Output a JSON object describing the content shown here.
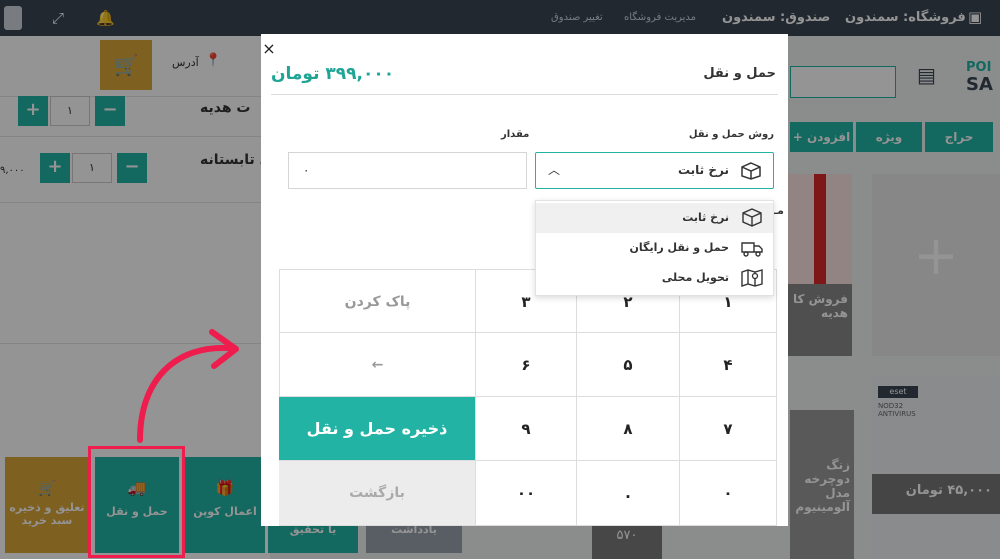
{
  "header": {
    "store": "فروشگاه: سمندون",
    "register": "صندوق: سمندون",
    "manage_store": "مدیریت فروشگاه",
    "change_register": "تغییر صندوق"
  },
  "background": {
    "address": "آدرس",
    "logo_text_1": "POI",
    "logo_text_2": "SA",
    "items": [
      {
        "name": "ت هدیه",
        "qty": "۱"
      },
      {
        "name": "گی تابستانه",
        "qty": "۱",
        "price": "۹,۰۰۰"
      }
    ],
    "categories": [
      "حراج",
      "ویژه",
      "افزودن"
    ],
    "products": [
      {
        "name": "فروش کا هدیه"
      },
      {
        "name": "زنگ دوچرخه مدل آلومینیوم"
      },
      {
        "name": "۴۵,۰۰۰ تومان"
      }
    ],
    "bottom_tiles": [
      "تعلیق و ذخیره سبد خرید",
      "حمل و نقل",
      "اعمال کوپن",
      "یادداشت",
      "یا تحقیق"
    ],
    "partial_price": "۵۷۰",
    "eset_label": "eset",
    "eset_sub": "NOD32 ANTIVIRUS"
  },
  "modal": {
    "close": "×",
    "title": "حمل و نقل",
    "total": "۳۹۹,۰۰۰ تومان",
    "method_label": "روش حمل و نقل",
    "amount_label": "مقدار",
    "selected_method": "نرخ ثابت",
    "amount_value": "۰",
    "extra_label": "مـ",
    "options": [
      "نرخ ثابت",
      "حمل و نقل رایگان",
      "تحویل محلی"
    ],
    "keys": {
      "k1": "۱",
      "k2": "۲",
      "k3": "۳",
      "k4": "۴",
      "k5": "۵",
      "k6": "۶",
      "k7": "۷",
      "k8": "۸",
      "k9": "۹",
      "k0": "۰",
      "dot": ".",
      "k00": "۰۰"
    },
    "clear": "پاک کردن",
    "backspace": "←",
    "save": "ذخیره حمل و نقل",
    "back": "بازگشت"
  },
  "colors": {
    "teal": "#22b3a4",
    "topbar": "#3a4553",
    "highlight": "#ee1d4d",
    "gold": "#d9a53a"
  }
}
